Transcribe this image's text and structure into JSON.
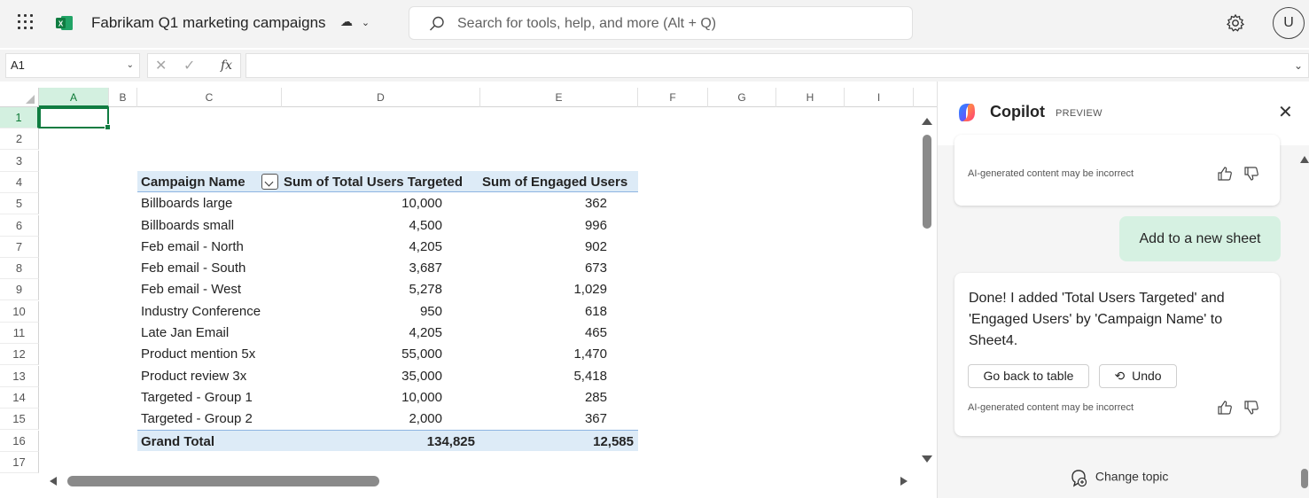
{
  "app": {
    "doc_title": "Fabrikam Q1 marketing campaigns",
    "search_placeholder": "Search for tools, help, and more (Alt + Q)",
    "avatar_initial": "U",
    "accent_color": "#107c41"
  },
  "formula_bar": {
    "name_box": "A1",
    "fx_label": "fx",
    "formula": ""
  },
  "grid": {
    "columns": [
      "A",
      "B",
      "C",
      "D",
      "E",
      "F",
      "G",
      "H",
      "I"
    ],
    "rows": [
      "1",
      "2",
      "3",
      "4",
      "5",
      "6",
      "7",
      "8",
      "9",
      "10",
      "11",
      "12",
      "13",
      "14",
      "15",
      "16",
      "17"
    ],
    "selected_cell": "A1"
  },
  "pivot": {
    "headers": [
      "Campaign Name",
      "Sum of Total Users Targeted",
      "Sum of Engaged Users"
    ],
    "rows": [
      [
        "Billboards large",
        "10,000",
        "362"
      ],
      [
        "Billboards small",
        "4,500",
        "996"
      ],
      [
        "Feb email - North",
        "4,205",
        "902"
      ],
      [
        "Feb email - South",
        "3,687",
        "673"
      ],
      [
        "Feb email - West",
        "5,278",
        "1,029"
      ],
      [
        "Industry Conference",
        "950",
        "618"
      ],
      [
        "Late Jan Email",
        "4,205",
        "465"
      ],
      [
        "Product mention 5x",
        "55,000",
        "1,470"
      ],
      [
        "Product review 3x",
        "35,000",
        "5,418"
      ],
      [
        "Targeted - Group 1",
        "10,000",
        "285"
      ],
      [
        "Targeted - Group 2",
        "2,000",
        "367"
      ]
    ],
    "total": [
      "Grand Total",
      "134,825",
      "12,585"
    ]
  },
  "copilot": {
    "title": "Copilot",
    "badge": "PREVIEW",
    "disclaimer": "AI-generated content may be incorrect",
    "user_message": "Add to a new sheet",
    "response": "Done! I added 'Total Users Targeted' and 'Engaged Users' by 'Campaign Name' to Sheet4.",
    "go_back_label": "Go back to table",
    "undo_label": "Undo",
    "change_topic_label": "Change topic"
  }
}
